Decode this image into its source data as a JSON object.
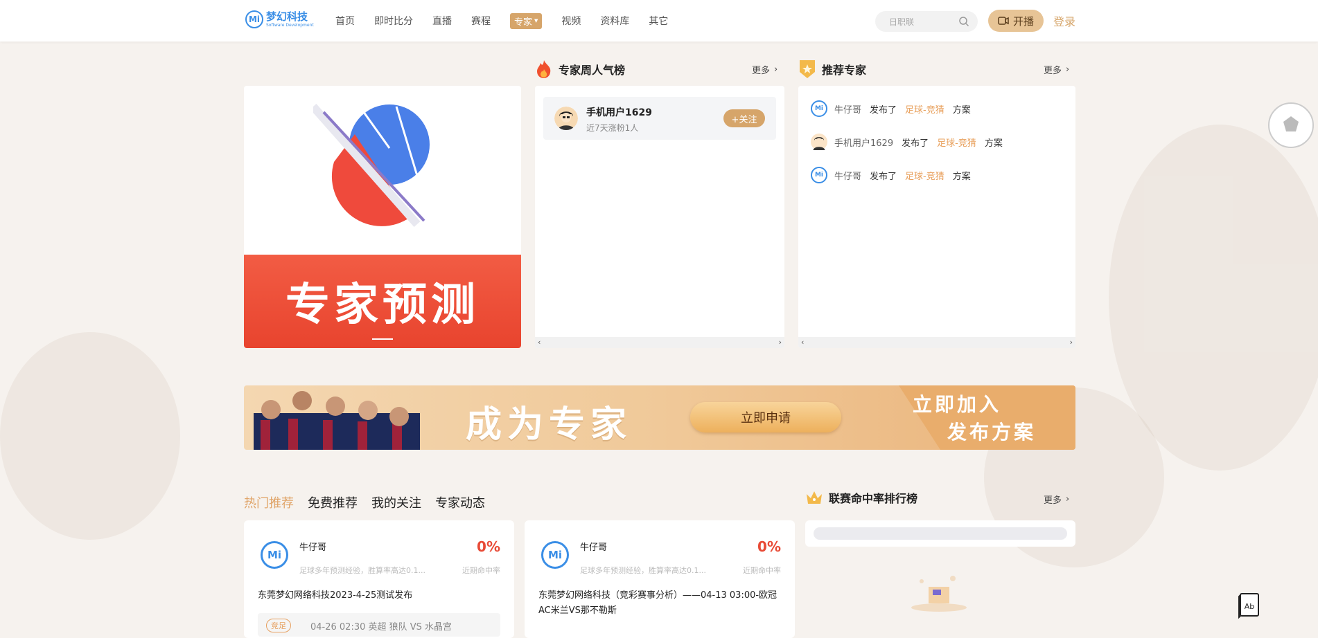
{
  "header": {
    "logo_text": "梦幻科技",
    "logo_sub": "Software Development",
    "logo_mark": "Mi",
    "nav": [
      {
        "label": "首页"
      },
      {
        "label": "即时比分"
      },
      {
        "label": "直播"
      },
      {
        "label": "赛程"
      },
      {
        "label": "专家",
        "active": true
      },
      {
        "label": "视频"
      },
      {
        "label": "资料库"
      },
      {
        "label": "其它"
      }
    ],
    "search_placeholder": "日职联",
    "live_label": "开播",
    "login_label": "登录"
  },
  "banner": {
    "title": "专家预测"
  },
  "weekly": {
    "title": "专家周人气榜",
    "more": "更多",
    "items": [
      {
        "name": "手机用户1629",
        "sub": "近7天涨粉1人",
        "follow": "+关注"
      }
    ]
  },
  "recommend": {
    "title": "推荐专家",
    "more": "更多",
    "items": [
      {
        "user": "牛仔哥",
        "verb": "发布了",
        "category": "足球-竞猜",
        "plan": "方案",
        "avatar": "mi"
      },
      {
        "user": "手机用户1629",
        "verb": "发布了",
        "category": "足球-竞猜",
        "plan": "方案",
        "avatar": "man"
      },
      {
        "user": "牛仔哥",
        "verb": "发布了",
        "category": "足球-竞猜",
        "plan": "方案",
        "avatar": "mi"
      }
    ]
  },
  "join": {
    "title": "成为专家",
    "apply": "立即申请",
    "slogan1": "立即加入",
    "slogan2": "发布方案"
  },
  "tabs": [
    {
      "label": "热门推荐",
      "active": true
    },
    {
      "label": "免费推荐"
    },
    {
      "label": "我的关注"
    },
    {
      "label": "专家动态"
    }
  ],
  "cards": [
    {
      "name": "牛仔哥",
      "desc": "足球多年预测经验，胜算率高达0.1...",
      "rate": "0%",
      "rate_label": "近期命中率",
      "title": "东莞梦幻网络科技2023-4-25测试发布",
      "tag": "竞足",
      "match": "04-26 02:30 英超 狼队 VS 水晶宫"
    },
    {
      "name": "牛仔哥",
      "desc": "足球多年预测经验，胜算率高达0.1...",
      "rate": "0%",
      "rate_label": "近期命中率",
      "title": "东莞梦幻网络科技（竞彩赛事分析）——04-13 03:00-欧冠AC米兰VS那不勒斯"
    }
  ],
  "league_rank": {
    "title": "联赛命中率排行榜",
    "more": "更多"
  },
  "colors": {
    "accent": "#d6a56a",
    "brand_blue": "#3a8ee6",
    "hit_red": "#e84a36"
  }
}
